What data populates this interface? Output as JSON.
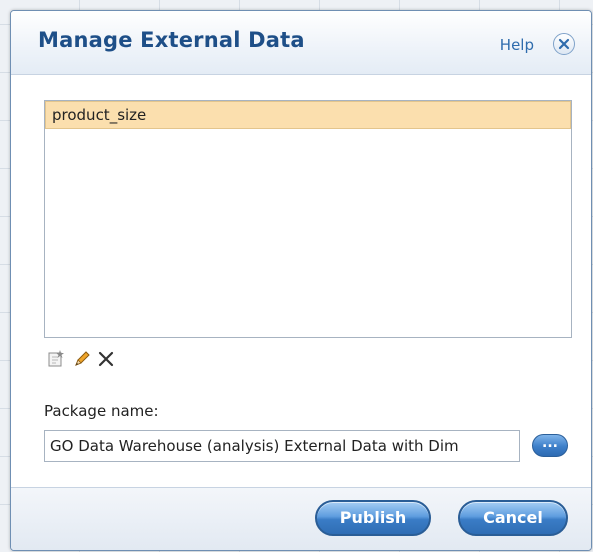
{
  "dialog": {
    "title": "Manage External Data",
    "help_label": "Help",
    "close_icon": "close-circle-icon"
  },
  "list": {
    "items": [
      {
        "label": "product_size",
        "selected": true
      }
    ]
  },
  "toolbar": {
    "new_icon": "new-item-icon",
    "edit_icon": "pencil-icon",
    "delete_icon": "delete-x-icon"
  },
  "package": {
    "label": "Package name:",
    "value": "GO Data Warehouse (analysis) External Data with Dim",
    "browse_label": "..."
  },
  "footer": {
    "publish_label": "Publish",
    "cancel_label": "Cancel"
  },
  "colors": {
    "title": "#1e4f88",
    "selection": "#fbdfae",
    "button": "#3a7cc6"
  }
}
